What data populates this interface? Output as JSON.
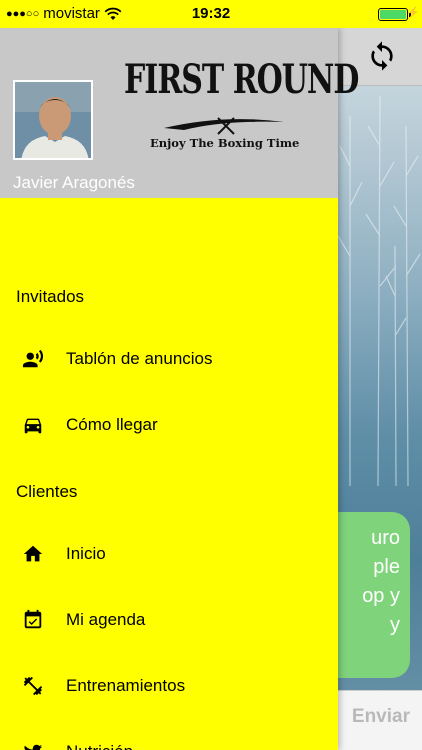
{
  "status_bar": {
    "carrier": "movistar",
    "time": "19:32"
  },
  "background_app": {
    "bubble_lines": [
      "uro",
      "ple",
      "op y",
      "y"
    ],
    "send_label": "Enviar"
  },
  "drawer": {
    "user_name": "Javier Aragonés",
    "logo_title": "FIRST ROUND",
    "logo_subtitle": "Enjoy The Boxing Time",
    "sections": [
      {
        "title": "Invitados",
        "items": [
          {
            "label": "Tablón de anuncios",
            "icon": "record-voice-icon"
          },
          {
            "label": "Cómo llegar",
            "icon": "car-icon"
          }
        ]
      },
      {
        "title": "Clientes",
        "items": [
          {
            "label": "Inicio",
            "icon": "home-icon"
          },
          {
            "label": "Mi agenda",
            "icon": "calendar-check-icon"
          },
          {
            "label": "Entrenamientos",
            "icon": "dumbbell-icon"
          },
          {
            "label": "Nutrición",
            "icon": "bird-icon"
          }
        ]
      }
    ]
  },
  "colors": {
    "drawer_bg": "#ffff00",
    "header_bg": "#c8c8c8",
    "bubble_bg": "#7fd37a"
  }
}
